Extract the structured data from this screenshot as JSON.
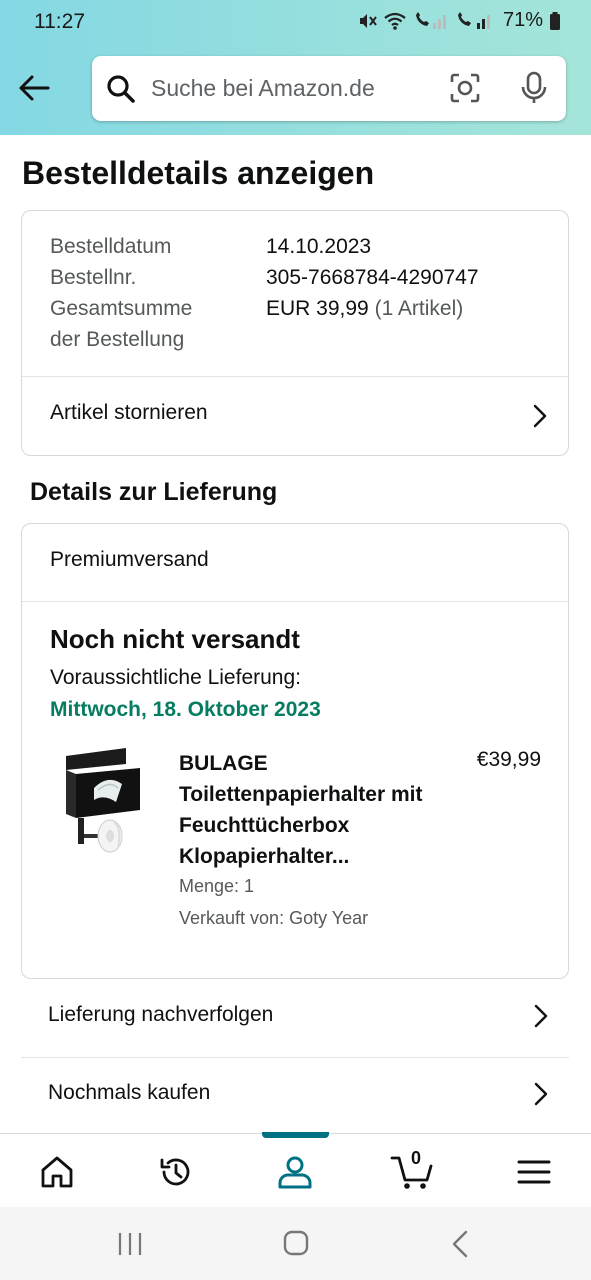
{
  "status_bar": {
    "time": "11:27",
    "battery": "71%"
  },
  "search": {
    "placeholder": "Suche bei Amazon.de"
  },
  "page": {
    "title": "Bestelldetails anzeigen"
  },
  "order_summary": {
    "date_label": "Bestelldatum",
    "date_value": "14.10.2023",
    "number_label": "Bestellnr.",
    "number_value": "305-7668784-4290747",
    "total_label_line1": "Gesamtsumme",
    "total_label_line2": "der Bestellung",
    "total_value": "EUR 39,99",
    "total_items": "(1 Artikel)",
    "cancel_label": "Artikel stornieren"
  },
  "delivery": {
    "section_title": "Details zur Lieferung",
    "shipping_method": "Premiumversand",
    "status": "Noch nicht versandt",
    "expected_label": "Voraussichtliche Lieferung:",
    "expected_date": "Mittwoch, 18. Oktober 2023",
    "accent_color": "#067d62"
  },
  "product": {
    "title": "BULAGE Toilettenpapierhalter mit Feuchttücherbox Klopapierhalter...",
    "price": "€39,99",
    "quantity": "Menge: 1",
    "seller": "Verkauft von: Goty Year",
    "image_icon": "toilet-paper-holder-image"
  },
  "actions": {
    "track_label": "Lieferung nachverfolgen",
    "buy_again_label": "Nochmals kaufen"
  },
  "bottom_nav": {
    "items": [
      "home-icon",
      "history-icon",
      "account-icon",
      "cart-icon",
      "menu-icon"
    ],
    "active": "account-icon",
    "cart_count": "0",
    "accent_color": "#007185"
  }
}
